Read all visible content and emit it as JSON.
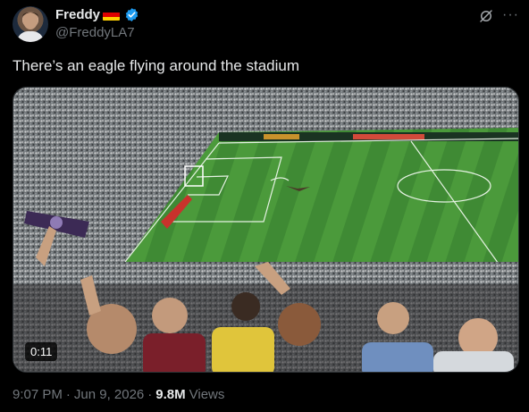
{
  "author": {
    "display_name": "Freddy",
    "handle": "@FreddyLA7",
    "flag": [
      "#000000",
      "#dd0000",
      "#ffce00"
    ],
    "verified_color": "#1d9bf0"
  },
  "icons": {
    "grok": "grok-icon",
    "more": "more-icon"
  },
  "more_glyph": "···",
  "tweet": {
    "text": "There’s an eagle flying around the stadium"
  },
  "media": {
    "duration": "0:11"
  },
  "meta": {
    "time": "9:07 PM",
    "dot1": "·",
    "date": "Jun 9, 2026",
    "dot2": "·",
    "views_count": "9.8M",
    "views_label": "Views"
  }
}
